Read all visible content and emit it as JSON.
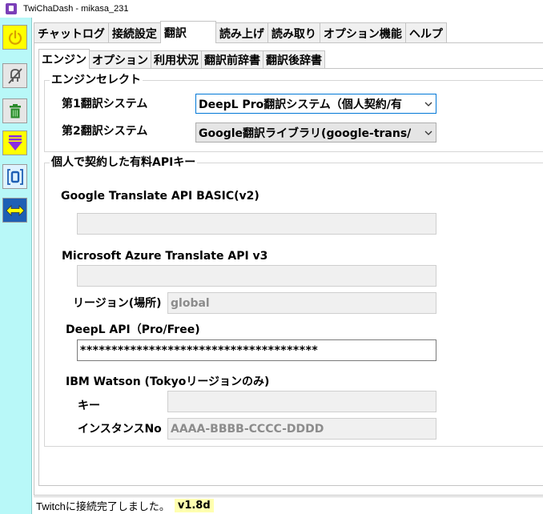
{
  "window": {
    "title": "TwiChaDash - mikasa_231"
  },
  "sidebar": {
    "buttons": [
      {
        "icon": "power-icon"
      },
      {
        "icon": "disconnect-icon"
      },
      {
        "icon": "trash-icon"
      },
      {
        "icon": "down-arrow-icon"
      },
      {
        "icon": "bracket-zero-icon"
      },
      {
        "icon": "swap-arrows-icon"
      }
    ]
  },
  "main_tabs": [
    {
      "label": "チャットログ"
    },
    {
      "label": "接続設定"
    },
    {
      "label": "翻訳",
      "active": true
    },
    {
      "label": "読み上げ"
    },
    {
      "label": "読み取り"
    },
    {
      "label": "オプション機能"
    },
    {
      "label": "ヘルプ"
    }
  ],
  "sub_tabs": [
    {
      "label": "エンジン",
      "active": true
    },
    {
      "label": "オプション"
    },
    {
      "label": "利用状況"
    },
    {
      "label": "翻訳前辞書"
    },
    {
      "label": "翻訳後辞書"
    }
  ],
  "engine_select": {
    "legend": "エンジンセレクト",
    "first_label": "第1翻訳システム",
    "first_value": "DeepL Pro翻訳システム（個人契約/有",
    "second_label": "第2翻訳システム",
    "second_value": "Google翻訳ライブラリ(google-trans/"
  },
  "api_keys": {
    "legend": "個人で契約した有料APIキー",
    "google_label": "Google Translate API BASIC(v2)",
    "google_value": "",
    "azure_label": "Microsoft Azure Translate API v3",
    "azure_value": "",
    "region_label": "リージョン(場所)",
    "region_value": "global",
    "deepl_label": "DeepL API（Pro/Free)",
    "deepl_value": "**************************************",
    "ibm_label": "IBM Watson (Tokyoリージョンのみ)",
    "ibm_key_label": "キー",
    "ibm_key_value": "",
    "ibm_instance_label": "インスタンスNo",
    "ibm_instance_value": "AAAA-BBBB-CCCC-DDDD"
  },
  "status": {
    "message": "Twitchに接続完了しました。",
    "version": "v1.8d"
  },
  "colors": {
    "sidebar_bg": "#b8f8f8",
    "power_button": "#ffff00",
    "down_arrow_button": "#ffff00",
    "arrow_purple": "#8a2be2",
    "swap_arrow": "#ffff00",
    "swap_bg": "#1e5fb4",
    "trash_green": "#2a8a2a",
    "version_bg": "#ffffb0"
  }
}
